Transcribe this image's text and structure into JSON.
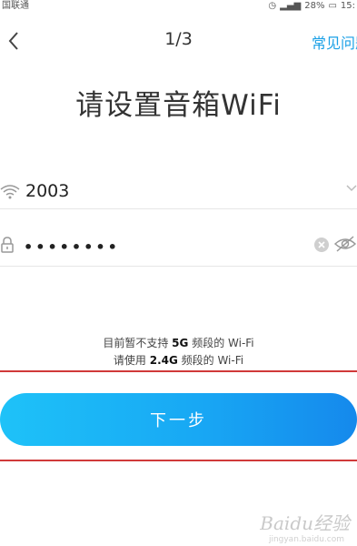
{
  "status_bar": {
    "carrier": "国联通",
    "battery": "28%",
    "time": "15:"
  },
  "header": {
    "step": "1/3",
    "faq_label": "常见问题"
  },
  "title": "请设置音箱WiFi",
  "wifi": {
    "ssid": "2003"
  },
  "password": {
    "value": "••••••••"
  },
  "notice": {
    "line1_pre": "目前暂不支持 ",
    "line1_bold": "5G",
    "line1_post": " 频段的 Wi-Fi",
    "line2_pre": "请使用 ",
    "line2_bold": "2.4G",
    "line2_post": " 频段的 Wi-Fi"
  },
  "next_button": "下一步",
  "watermark": {
    "main": "Baidu经验",
    "sub": "jingyan.baidu.com"
  },
  "colors": {
    "accent": "#1aa0e6",
    "highlight": "#d03a3a"
  }
}
